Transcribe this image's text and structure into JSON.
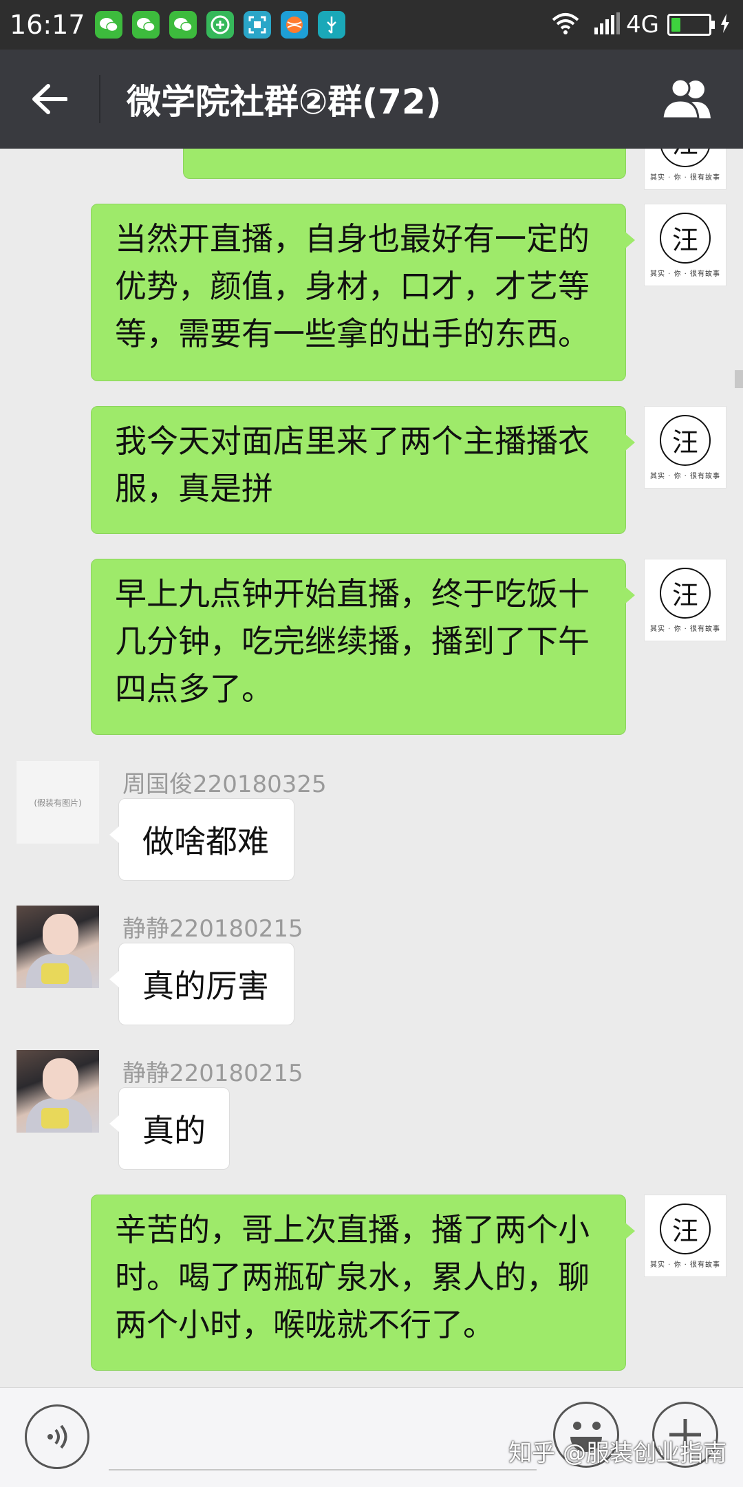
{
  "status_bar": {
    "time": "16:17",
    "network": "4G",
    "battery_level": 0.25,
    "notification_icons": [
      "wechat-icon",
      "wechat-icon",
      "wechat-icon",
      "plus-app-icon",
      "scan-icon",
      "ball-app-icon",
      "usb-icon"
    ]
  },
  "header": {
    "title": "微学院社群②群(72)"
  },
  "messages": [
    {
      "direction": "out",
      "text": "当然开直播，自身也最好有一定的优势，颜值，身材，口才，才艺等等，需要有一些拿的出手的东西。"
    },
    {
      "direction": "out",
      "text": "我今天对面店里来了两个主播播衣服，真是拼"
    },
    {
      "direction": "out",
      "text": "早上九点钟开始直播，终于吃饭十几分钟，吃完继续播，播到了下午四点多了。"
    },
    {
      "direction": "in",
      "sender": "周国俊220180325",
      "text": "做啥都难"
    },
    {
      "direction": "in",
      "sender": "静静220180215",
      "text": "真的厉害"
    },
    {
      "direction": "in",
      "sender": "静静220180215",
      "text": "真的"
    },
    {
      "direction": "out",
      "text": "辛苦的，哥上次直播，播了两个小时。喝了两瓶矿泉水，累人的，聊两个小时，喉咙就不行了。"
    }
  ],
  "avatars": {
    "self_logo_char": "汪",
    "self_logo_caption": "其实 · 你 · 很有故事",
    "placeholder_text": "(假装有图片)"
  },
  "watermark": "知乎 @服装创业指南",
  "colors": {
    "outgoing_bubble": "#9eea6a",
    "incoming_bubble": "#ffffff",
    "title_bar": "#393a3f",
    "status_bar": "#2e2e2e"
  }
}
